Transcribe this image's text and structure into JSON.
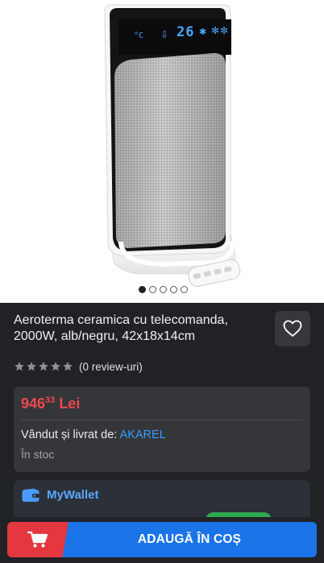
{
  "product": {
    "title": "Aeroterma ceramica cu telecomanda, 2000W, alb/negru, 42x18x14cm",
    "display_unit": "°C",
    "display_temp": "26",
    "gallery_dots": 5,
    "gallery_active_index": 0
  },
  "rating": {
    "stars": 0,
    "reviews_label": "(0 review-uri)"
  },
  "price": {
    "integer": "946",
    "decimals": "33",
    "currency": "Lei"
  },
  "seller": {
    "prefix": "Vândut și livrat de:",
    "name": "AKAREL"
  },
  "stock": "În stoc",
  "wallet": {
    "label": "MyWallet"
  },
  "actions": {
    "add_to_cart": "ADAUGĂ ÎN COȘ"
  },
  "icons": {
    "favorite": "heart-icon",
    "cart": "cart-icon",
    "wallet": "wallet-icon",
    "star": "star-icon"
  },
  "colors": {
    "price": "#f0474f",
    "link": "#3b9bff",
    "cart_button": "#1b73e8",
    "cart_icon_bg": "#e4373f",
    "card_bg": "#34363a",
    "page_bg": "#202225"
  }
}
